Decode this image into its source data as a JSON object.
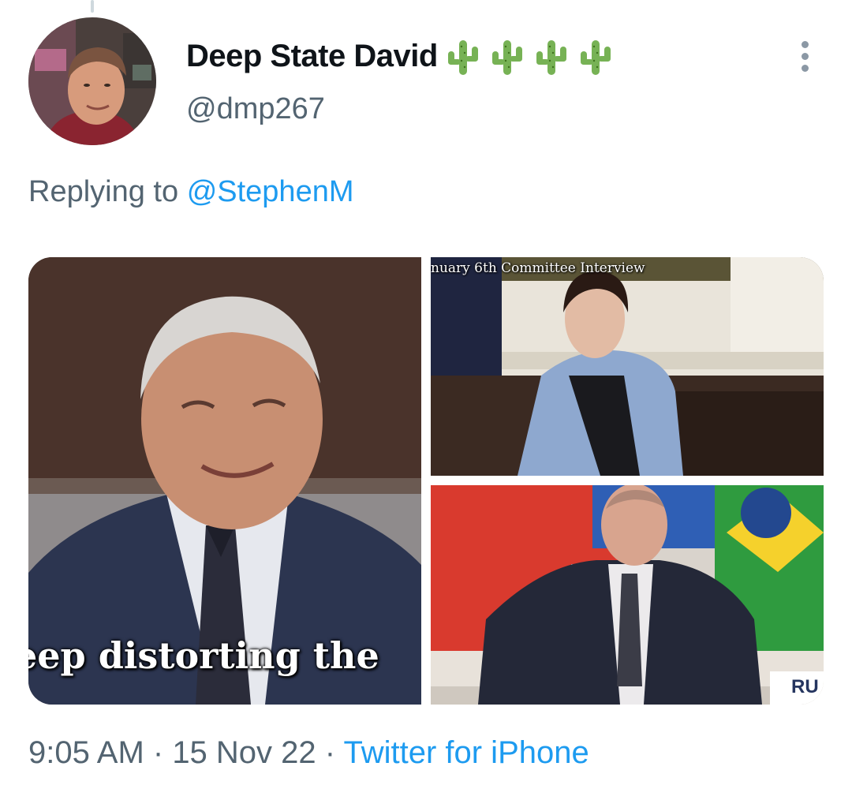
{
  "tweet": {
    "display_name": "Deep State David",
    "name_emoji": [
      "cactus",
      "cactus",
      "cactus",
      "cactus"
    ],
    "handle": "@dmp267",
    "reply_prefix": "Replying to",
    "reply_mention": "@StephenM",
    "media": [
      {
        "kind": "video-still",
        "caption": "eep distorting the"
      },
      {
        "kind": "video-still",
        "overlay_text": "nuary 6th Committee Interview"
      },
      {
        "kind": "video-still",
        "overlay_text": "RU"
      }
    ],
    "time": "9:05 AM",
    "separator": " · ",
    "date": "15 Nov 22",
    "source": "Twitter for iPhone"
  },
  "colors": {
    "text_primary": "#0f1419",
    "text_secondary": "#536471",
    "link": "#1d9bf0",
    "thread_line": "#cfd9de"
  }
}
